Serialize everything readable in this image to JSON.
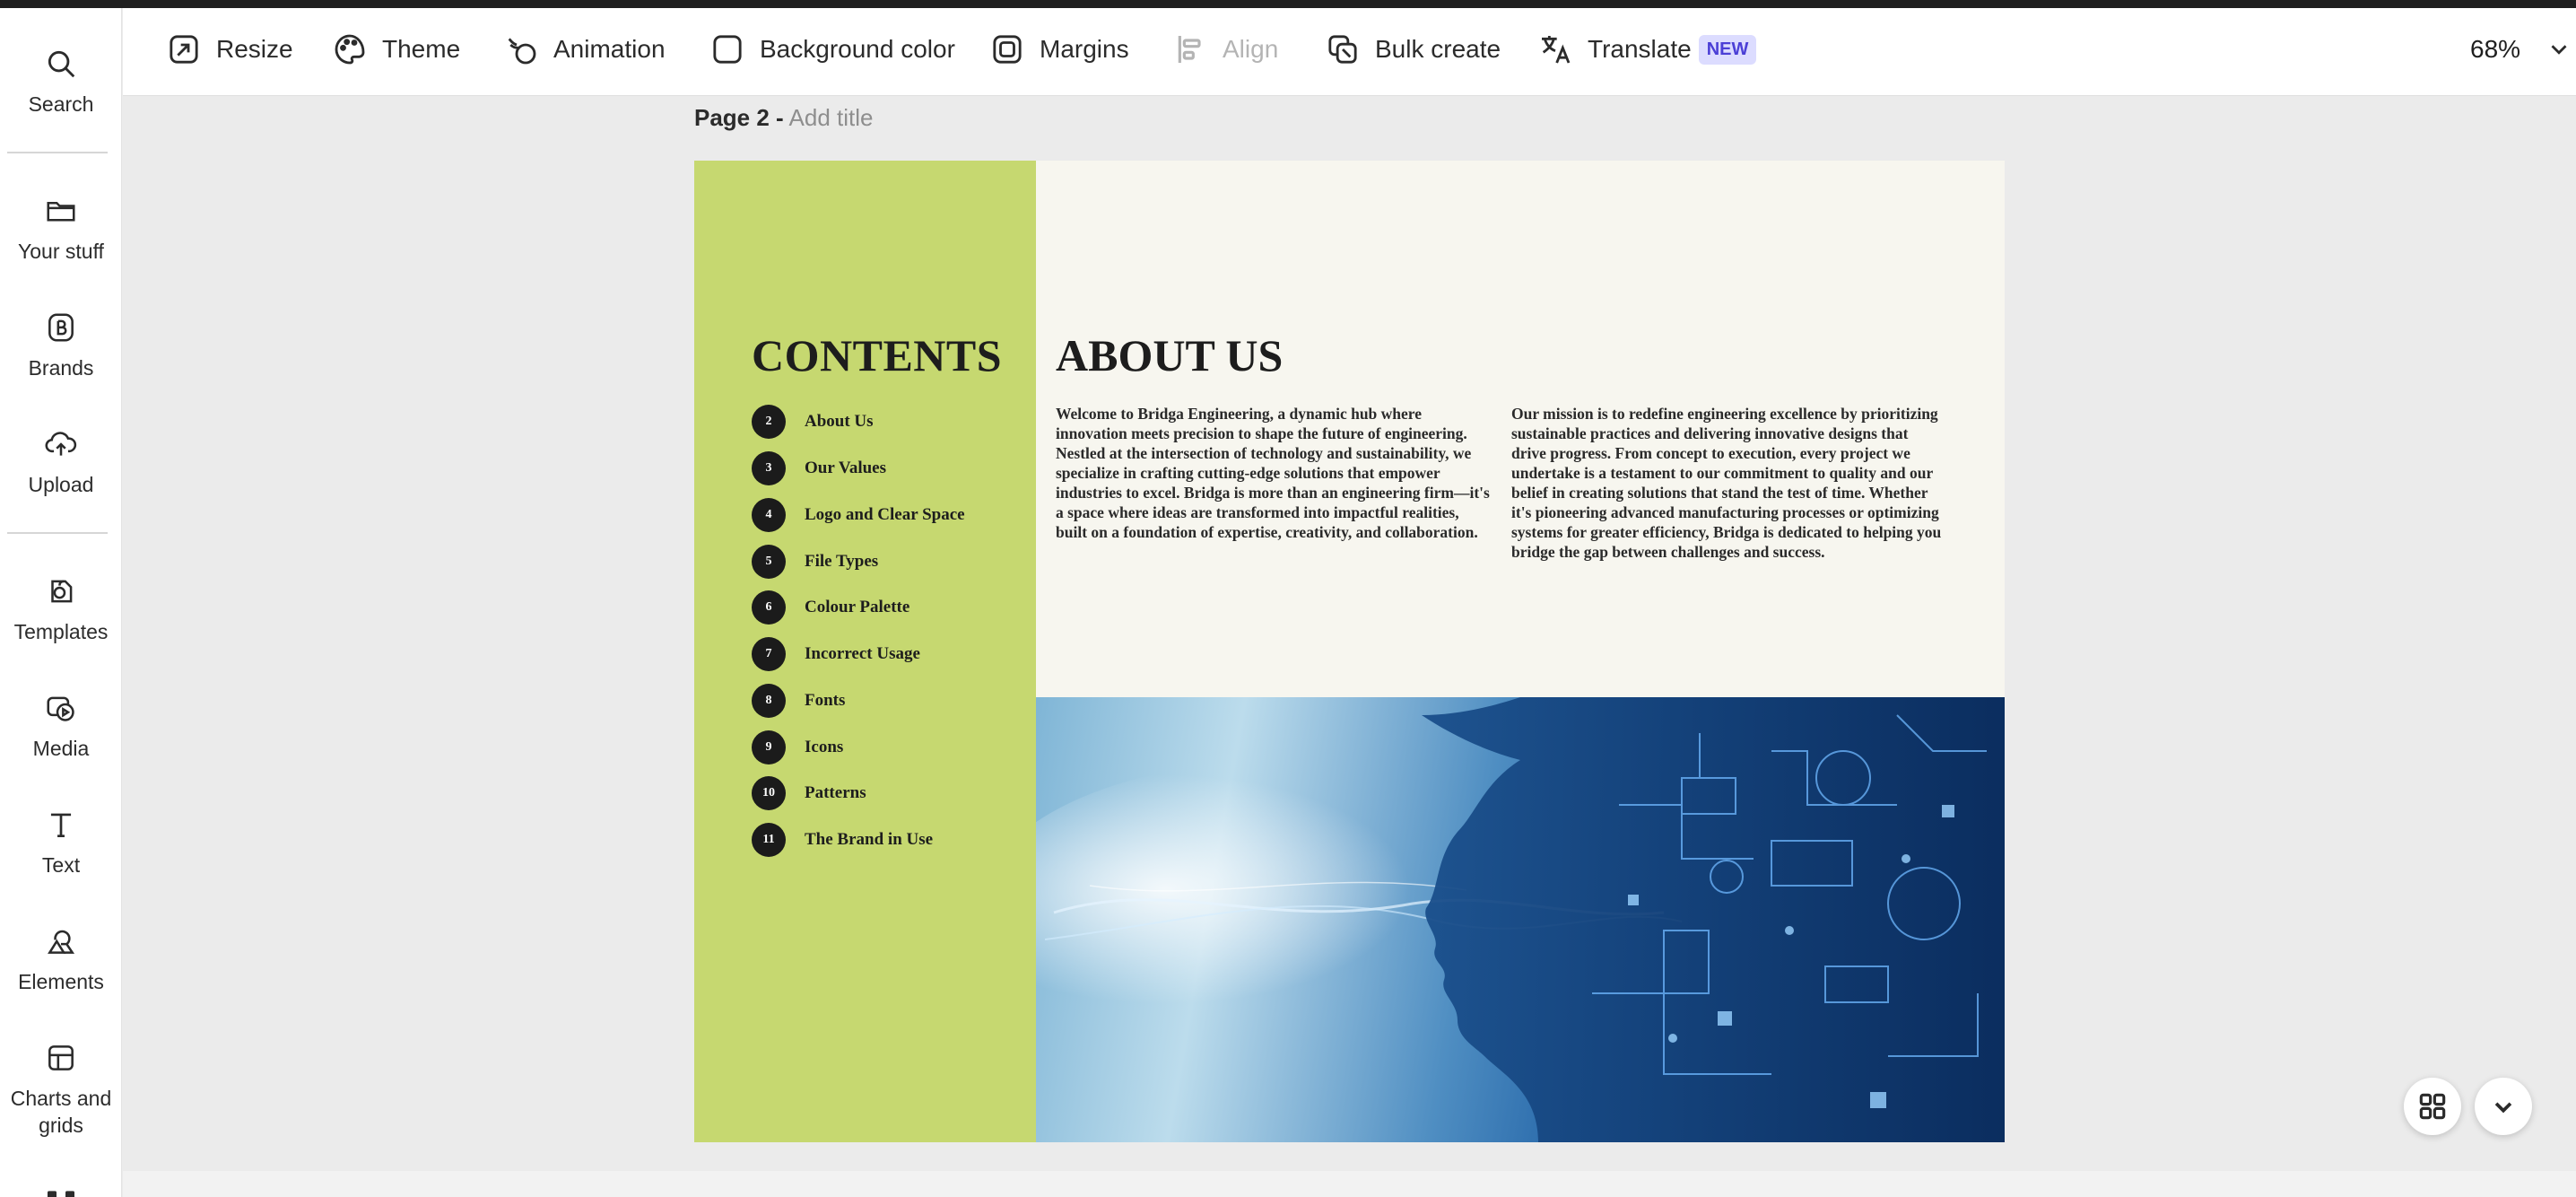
{
  "rail": {
    "items": [
      {
        "label": "Search",
        "icon": "search-icon"
      },
      {
        "label": "Your stuff",
        "icon": "folder-icon"
      },
      {
        "label": "Brands",
        "icon": "brand-icon"
      },
      {
        "label": "Upload",
        "icon": "upload-icon"
      },
      {
        "label": "Templates",
        "icon": "templates-icon"
      },
      {
        "label": "Media",
        "icon": "media-icon"
      },
      {
        "label": "Text",
        "icon": "text-icon"
      },
      {
        "label": "Elements",
        "icon": "elements-icon"
      },
      {
        "label": "Charts and grids",
        "icon": "charts-grids-icon"
      }
    ]
  },
  "toolbar": {
    "resize": "Resize",
    "theme": "Theme",
    "animation": "Animation",
    "background_color": "Background color",
    "margins": "Margins",
    "align": "Align",
    "bulk_create": "Bulk create",
    "translate": "Translate",
    "translate_badge": "NEW",
    "zoom": "68%"
  },
  "page": {
    "label": "Page 2 -",
    "title_placeholder": "Add title"
  },
  "doc": {
    "contents_title": "CONTENTS",
    "toc": [
      {
        "num": "2",
        "label": "About Us"
      },
      {
        "num": "3",
        "label": "Our Values"
      },
      {
        "num": "4",
        "label": "Logo and Clear Space"
      },
      {
        "num": "5",
        "label": "File Types"
      },
      {
        "num": "6",
        "label": "Colour Palette"
      },
      {
        "num": "7",
        "label": "Incorrect Usage"
      },
      {
        "num": "8",
        "label": "Fonts"
      },
      {
        "num": "9",
        "label": "Icons"
      },
      {
        "num": "10",
        "label": "Patterns"
      },
      {
        "num": "11",
        "label": "The Brand in Use"
      }
    ],
    "about_title": "ABOUT US",
    "about_col1": "Welcome to Bridga Engineering, a dynamic hub where innovation meets precision to shape the future of engineering. Nestled at the intersection of technology and sustainability, we specialize in crafting cutting-edge solutions that empower industries to excel. Bridga is more than an engineering firm—it's a space where ideas are transformed into impactful realities, built on a foundation of expertise, creativity, and collaboration.",
    "about_col2": "Our mission is to redefine engineering excellence by prioritizing sustainable practices and delivering innovative designs that drive progress. From concept to execution, every project we undertake is a testament to our commitment to quality and our belief in creating solutions that stand the test of time. Whether it's pioneering advanced manufacturing processes or optimizing systems for greater efficiency, Bridga is dedicated to helping you bridge the gap between challenges and success."
  },
  "colors": {
    "sidebar_green": "#c6d870",
    "doc_bg": "#f7f6ef",
    "badge_bg": "#dcdcff",
    "badge_text": "#4b3fd6"
  }
}
